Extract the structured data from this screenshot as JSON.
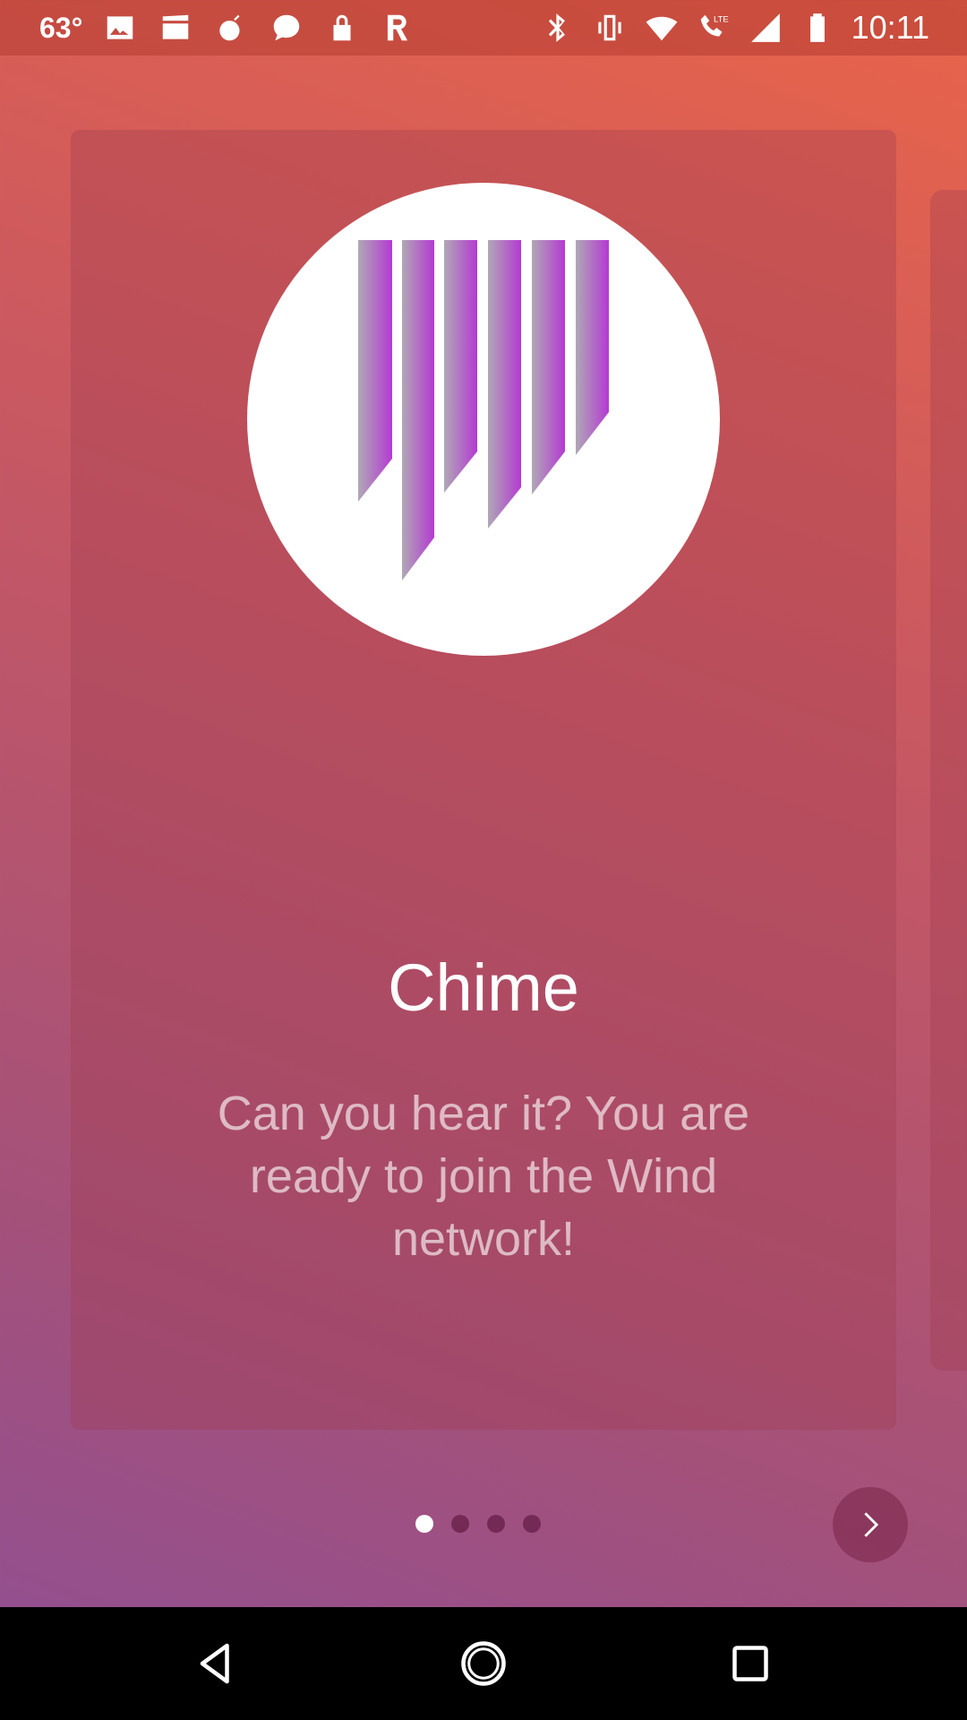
{
  "status_bar": {
    "temperature": "63°",
    "time": "10:11",
    "left_icons": [
      "image-icon",
      "clapper-icon",
      "bomb-icon",
      "chat-heart-icon",
      "lock-icon",
      "r-app-icon"
    ],
    "right_icons": [
      "bluetooth-icon",
      "vibrate-icon",
      "wifi-icon",
      "lte-call-icon",
      "cell-signal-icon",
      "battery-icon"
    ]
  },
  "onboarding": {
    "title": "Chime",
    "description": "Can you hear it? You are ready to join the Wind network!",
    "logo_icon": "chime-logo-icon",
    "page_count": 4,
    "current_page": 1
  },
  "controls": {
    "next_icon": "chevron-right-icon"
  },
  "nav_bar": {
    "back_icon": "back-triangle-icon",
    "home_icon": "home-circle-icon",
    "recents_icon": "recents-square-icon"
  },
  "colors": {
    "gradient_top": "#e8644a",
    "gradient_bottom": "#8f4f94",
    "logo_gray": "#b0a8b6",
    "logo_purple": "#b43ad2"
  }
}
